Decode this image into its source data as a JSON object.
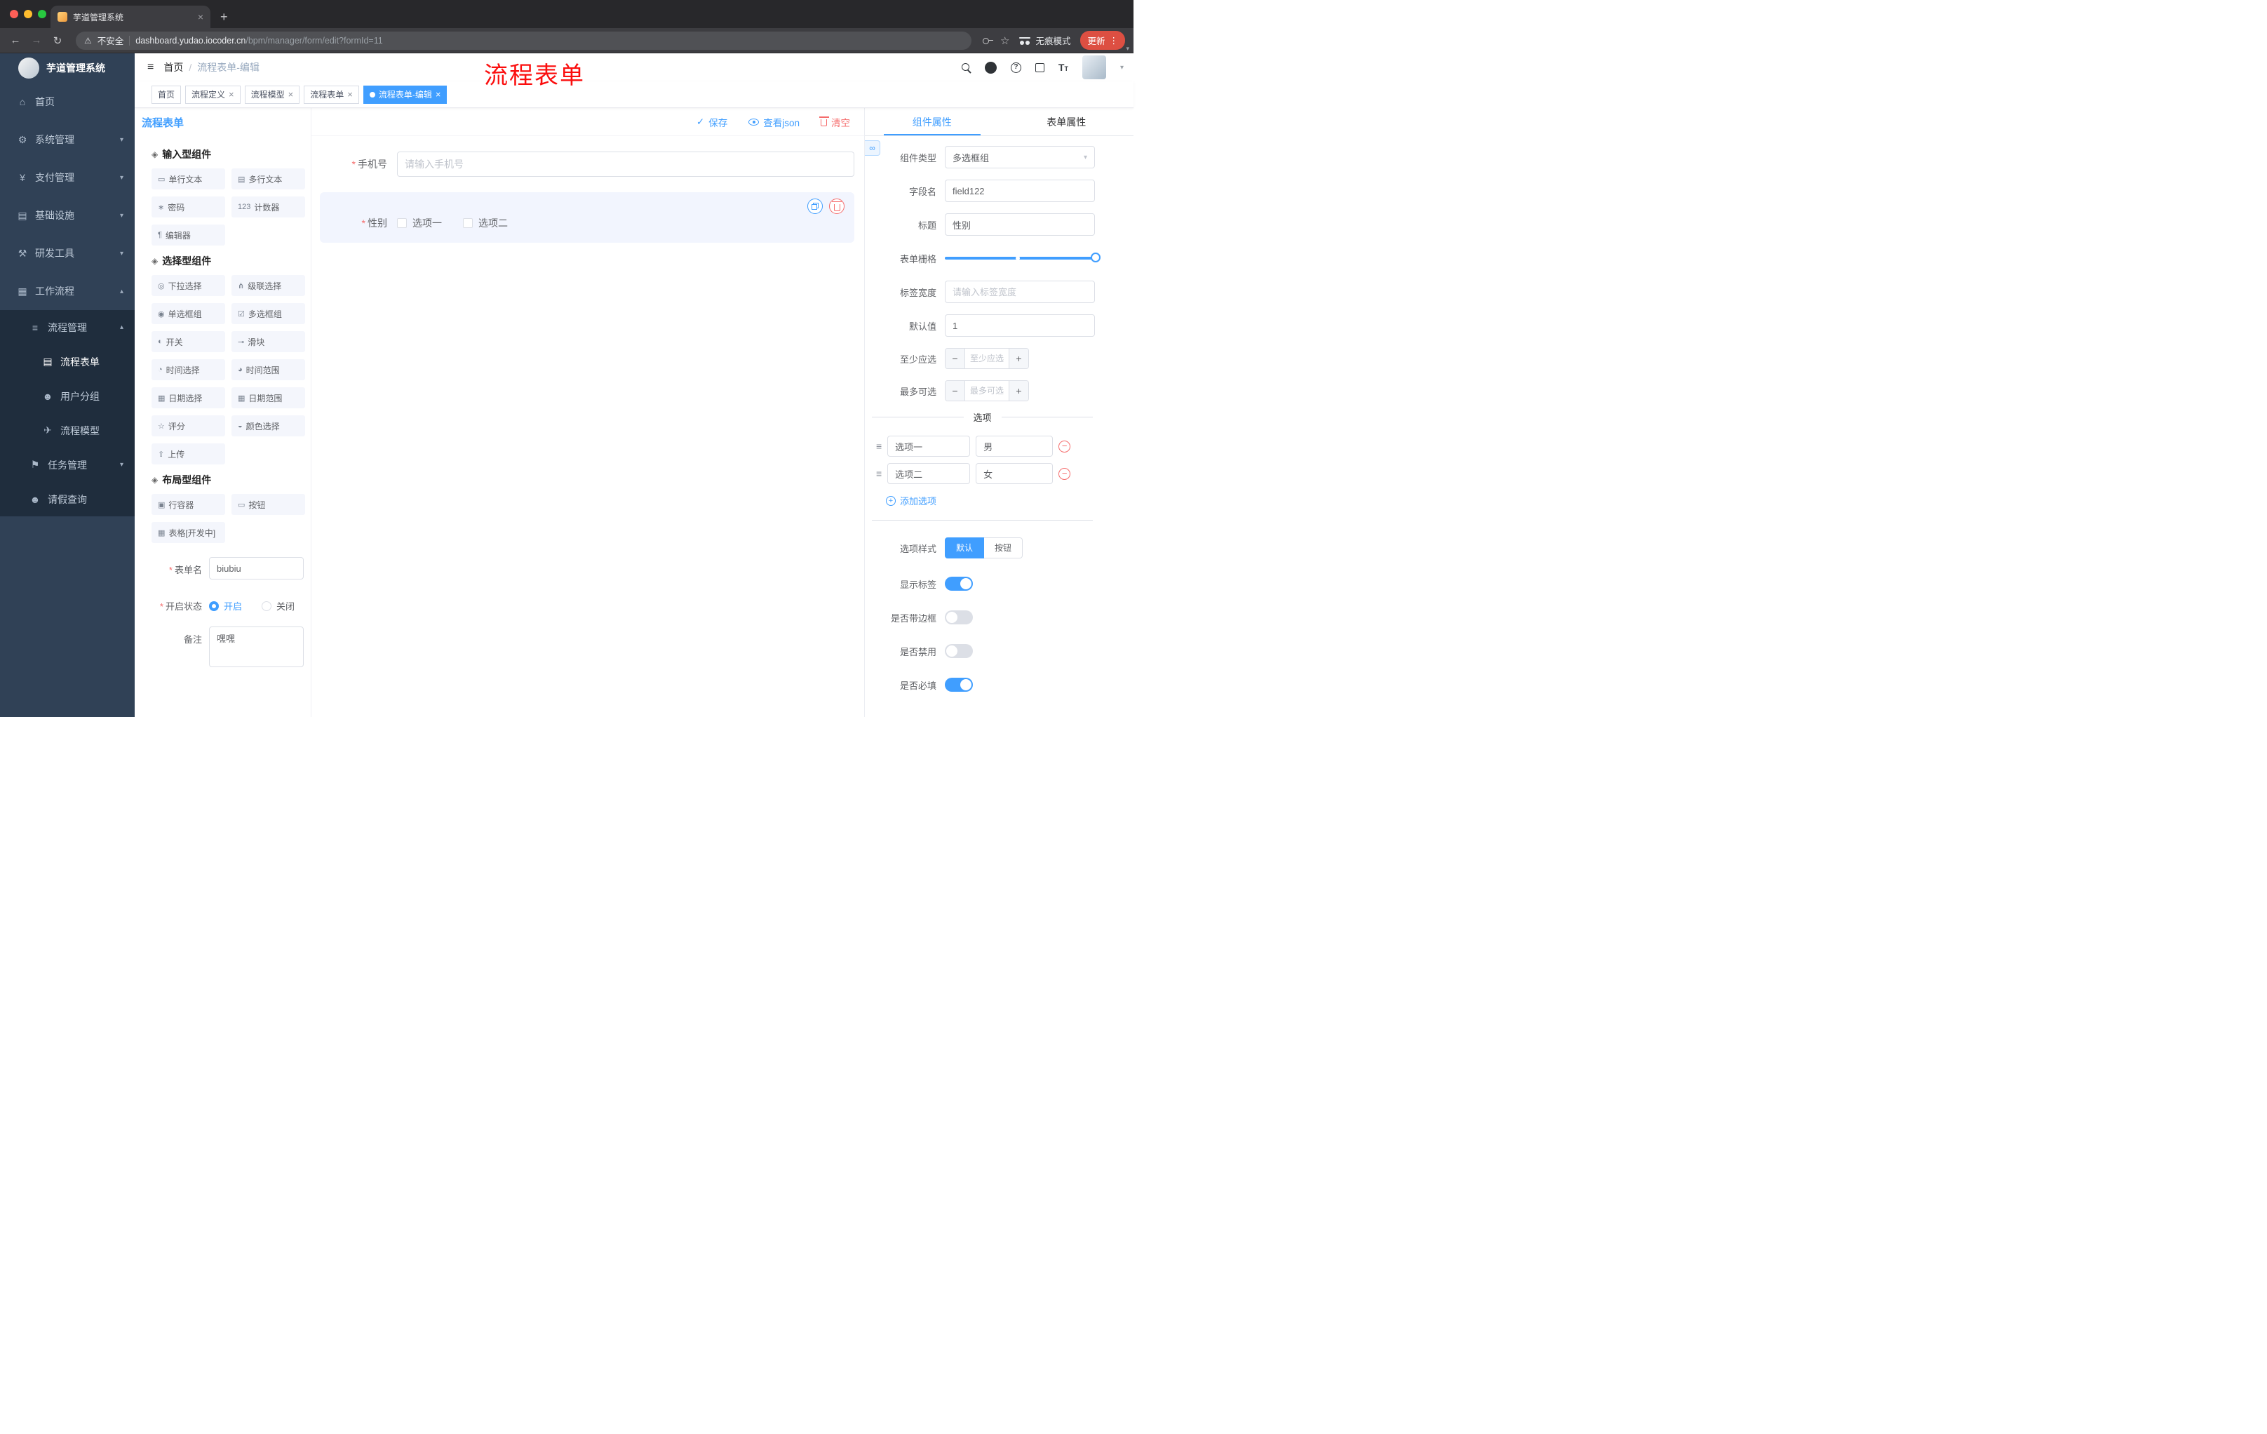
{
  "browser": {
    "tab_title": "芋道管理系统",
    "security_text": "不安全",
    "url_domain": "dashboard.yudao.iocoder.cn",
    "url_path": "/bpm/manager/form/edit?formId=11",
    "incognito_label": "无痕模式",
    "update_label": "更新"
  },
  "icons": {
    "close": "×",
    "more": "⋮",
    "new_tab": "+",
    "back": "←",
    "forward": "→",
    "reload": "↻",
    "warning": "⚠",
    "star": "☆",
    "hamburger": "≡",
    "breadcrumb_sep": "/",
    "caret_down": "▾",
    "check": "✓",
    "group_header": "◈",
    "drag_handle": "≡",
    "link": "∞",
    "plus": "+",
    "minus": "−",
    "question": "?"
  },
  "misc": {
    "required": "*"
  },
  "sidebar": {
    "title": "芋道管理系统",
    "items": [
      {
        "label": "首页",
        "icon": "⌂"
      },
      {
        "label": "系统管理",
        "icon": "⚙",
        "chevron": "▾"
      },
      {
        "label": "支付管理",
        "icon": "¥",
        "chevron": "▾"
      },
      {
        "label": "基础设施",
        "icon": "▤",
        "chevron": "▾"
      },
      {
        "label": "研发工具",
        "icon": "⚒",
        "chevron": "▾"
      },
      {
        "label": "工作流程",
        "icon": "▦",
        "chevron": "▴"
      },
      {
        "label": "流程管理",
        "icon": "≡",
        "chevron": "▴"
      },
      {
        "label": "流程表单",
        "icon": "▤"
      },
      {
        "label": "用户分组",
        "icon": "☻"
      },
      {
        "label": "流程模型",
        "icon": "✈"
      },
      {
        "label": "任务管理",
        "icon": "⚑",
        "chevron": "▾"
      },
      {
        "label": "请假查询",
        "icon": "☻"
      }
    ]
  },
  "header": {
    "breadcrumb": [
      "首页",
      "流程表单-编辑"
    ],
    "annotation": "流程表单"
  },
  "tags": [
    {
      "label": "首页"
    },
    {
      "label": "流程定义"
    },
    {
      "label": "流程模型"
    },
    {
      "label": "流程表单"
    },
    {
      "label": "流程表单-编辑"
    }
  ],
  "left_panel": {
    "title": "流程表单",
    "groups": [
      {
        "title": "输入型组件",
        "items": [
          {
            "label": "单行文本",
            "icon": "▭"
          },
          {
            "label": "多行文本",
            "icon": "▤"
          },
          {
            "label": "密码",
            "icon": "∗"
          },
          {
            "label": "计数器",
            "icon": "123"
          },
          {
            "label": "编辑器",
            "icon": "¶"
          }
        ]
      },
      {
        "title": "选择型组件",
        "items": [
          {
            "label": "下拉选择",
            "icon": "◎"
          },
          {
            "label": "级联选择",
            "icon": "⋔"
          },
          {
            "label": "单选框组",
            "icon": "◉"
          },
          {
            "label": "多选框组",
            "icon": "☑"
          },
          {
            "label": "开关",
            "icon": "◐"
          },
          {
            "label": "滑块",
            "icon": "⊸"
          },
          {
            "label": "时间选择",
            "icon": "◔"
          },
          {
            "label": "时间范围",
            "icon": "◕"
          },
          {
            "label": "日期选择",
            "icon": "▦"
          },
          {
            "label": "日期范围",
            "icon": "▦"
          },
          {
            "label": "评分",
            "icon": "☆"
          },
          {
            "label": "颜色选择",
            "icon": "◒"
          },
          {
            "label": "上传",
            "icon": "⇧"
          }
        ]
      },
      {
        "title": "布局型组件",
        "items": [
          {
            "label": "行容器",
            "icon": "▣"
          },
          {
            "label": "按钮",
            "icon": "▭"
          },
          {
            "label": "表格[开发中]",
            "icon": "▦"
          }
        ]
      }
    ],
    "form": {
      "name_label": "表单名",
      "name_value": "biubiu",
      "status_label": "开启状态",
      "status_on": "开启",
      "status_off": "关闭",
      "remark_label": "备注",
      "remark_value": "嘿嘿"
    }
  },
  "toolbar": {
    "save": "保存",
    "view_json": "查看json",
    "clear": "清空"
  },
  "canvas": {
    "phone_label": "手机号",
    "phone_placeholder": "请输入手机号",
    "gender_label": "性别",
    "gender_options": [
      "选项一",
      "选项二"
    ]
  },
  "right_panel": {
    "tabs": [
      "组件属性",
      "表单属性"
    ],
    "component_type_label": "组件类型",
    "component_type_value": "多选框组",
    "field_name_label": "字段名",
    "field_name_value": "field122",
    "title_label": "标题",
    "title_value": "性别",
    "grid_label": "表单栅格",
    "label_width_label": "标签宽度",
    "label_width_placeholder": "请输入标签宽度",
    "default_label": "默认值",
    "default_value": "1",
    "min_label": "至少应选",
    "min_placeholder": "至少应选",
    "max_label": "最多可选",
    "max_placeholder": "最多可选",
    "options_title": "选项",
    "options": [
      {
        "label": "选项一",
        "value": "男"
      },
      {
        "label": "选项二",
        "value": "女"
      }
    ],
    "add_option": "添加选项",
    "style_label": "选项样式",
    "style_options": [
      "默认",
      "按钮"
    ],
    "switch_rows": [
      {
        "label": "显示标签"
      },
      {
        "label": "是否带边框"
      },
      {
        "label": "是否禁用"
      },
      {
        "label": "是否必填"
      }
    ]
  }
}
